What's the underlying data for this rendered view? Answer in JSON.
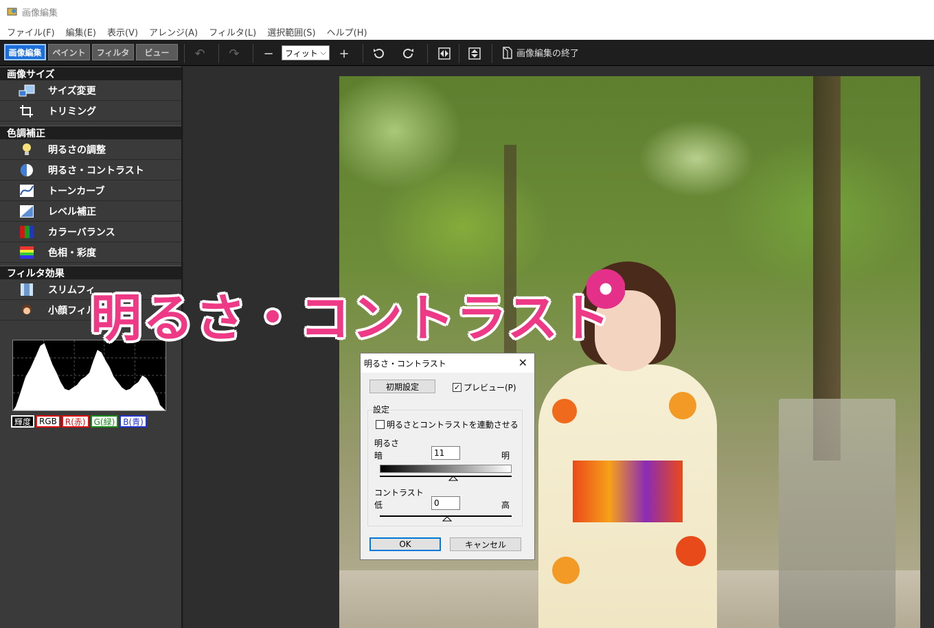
{
  "window": {
    "title": "画像編集"
  },
  "menu": [
    "ファイル(F)",
    "編集(E)",
    "表示(V)",
    "アレンジ(A)",
    "フィルタ(L)",
    "選択範囲(S)",
    "ヘルプ(H)"
  ],
  "mode_tabs": [
    {
      "label": "画像編集",
      "active": true
    },
    {
      "label": "ペイント",
      "active": false
    },
    {
      "label": "フィルタ",
      "active": false
    },
    {
      "label": "ビュー",
      "active": false
    }
  ],
  "toolbar": {
    "zoom_value": "フィット",
    "end_label": "画像編集の終了",
    "icons": [
      "undo-icon",
      "redo-icon",
      "zoom-out-icon",
      "zoom-in-icon",
      "rotate-left-icon",
      "rotate-right-icon",
      "flip-horizontal-icon",
      "flip-vertical-icon",
      "document-icon"
    ]
  },
  "sidebar": {
    "sections": [
      {
        "header": "画像サイズ",
        "items": [
          {
            "label": "サイズ変更",
            "icon": "resize-icon"
          },
          {
            "label": "トリミング",
            "icon": "crop-icon"
          }
        ]
      },
      {
        "header": "色調補正",
        "items": [
          {
            "label": "明るさの調整",
            "icon": "lightbulb-icon"
          },
          {
            "label": "明るさ・コントラスト",
            "icon": "contrast-icon"
          },
          {
            "label": "トーンカーブ",
            "icon": "tone-curve-icon"
          },
          {
            "label": "レベル補正",
            "icon": "levels-icon"
          },
          {
            "label": "カラーバランス",
            "icon": "color-balance-icon"
          },
          {
            "label": "色相・彩度",
            "icon": "hue-saturation-icon"
          }
        ]
      },
      {
        "header": "フィルタ効果",
        "items": [
          {
            "label": "スリムフィ",
            "icon": "slim-filter-icon"
          },
          {
            "label": "小顔フィル",
            "icon": "small-face-icon"
          }
        ]
      }
    ],
    "histogram_buttons": [
      {
        "label": "輝度",
        "active": true,
        "cls": ""
      },
      {
        "label": "RGB",
        "active": false,
        "cls": "rgb"
      },
      {
        "label": "R(赤)",
        "active": false,
        "cls": "r"
      },
      {
        "label": "G(緑)",
        "active": false,
        "cls": "g"
      },
      {
        "label": "B(青)",
        "active": false,
        "cls": "b"
      }
    ]
  },
  "caption": "明るさ・コントラスト",
  "dialog": {
    "title": "明るさ・コントラスト",
    "reset_button": "初期設定",
    "preview_label": "プレビュー(P)",
    "preview_checked": true,
    "group_label": "設定",
    "link_label": "明るさとコントラストを連動させる",
    "link_checked": false,
    "brightness_label": "明るさ",
    "brightness_low": "暗",
    "brightness_high": "明",
    "brightness_value": "11",
    "contrast_label": "コントラスト",
    "contrast_low": "低",
    "contrast_high": "高",
    "contrast_value": "0",
    "ok_button": "OK",
    "cancel_button": "キャンセル"
  },
  "colors": {
    "accent": "#1c6fd8",
    "caption": "#ee3a86",
    "sidebar_bg": "#3a3a3a",
    "toolbar_bg": "#1e1e1e"
  }
}
